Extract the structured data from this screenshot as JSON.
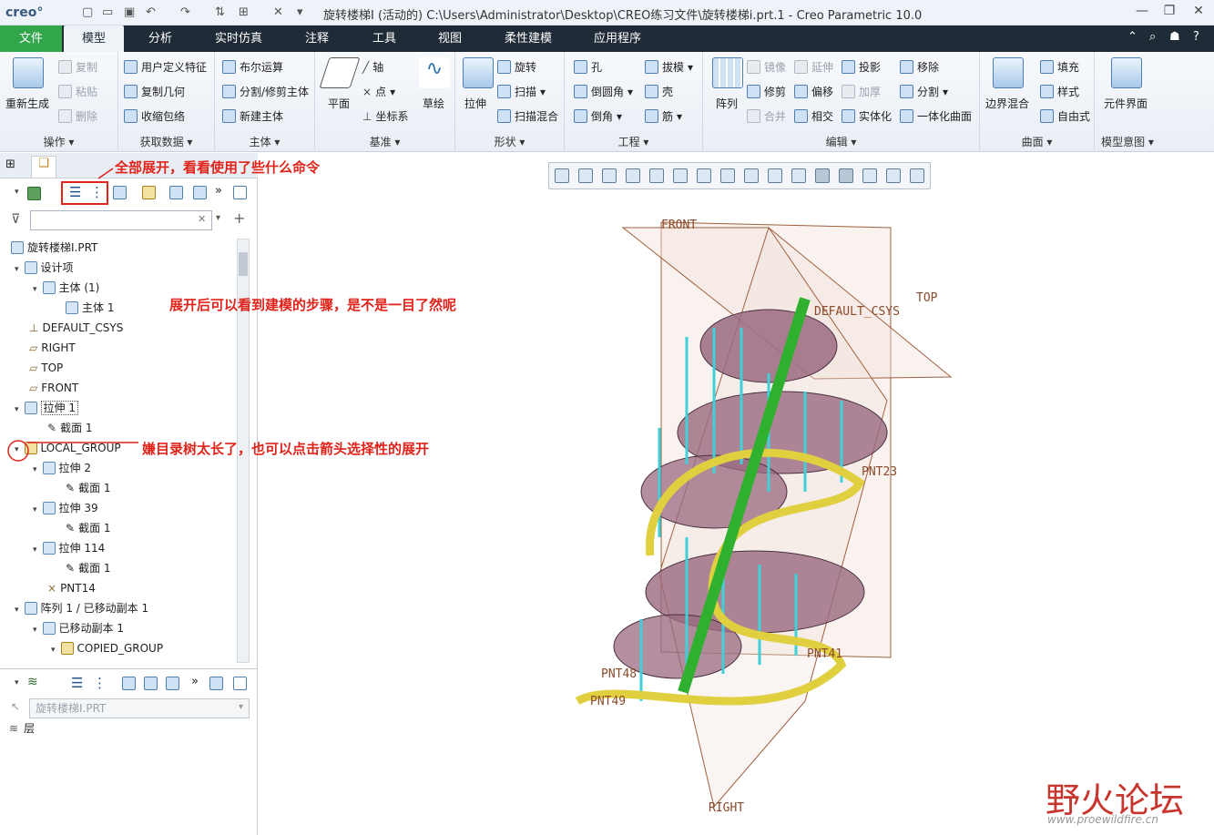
{
  "titlebar": {
    "logo": "creo°",
    "title": "旋转楼梯I (活动的) C:\\Users\\Administrator\\Desktop\\CREO练习文件\\旋转楼梯i.prt.1 - Creo Parametric 10.0"
  },
  "menu": {
    "tabs": [
      "文件",
      "模型",
      "分析",
      "实时仿真",
      "注释",
      "工具",
      "视图",
      "柔性建模",
      "应用程序"
    ],
    "active": "模型"
  },
  "ribbon": {
    "ops": {
      "label": "操作",
      "regen": "重新生成",
      "copy": "复制",
      "paste": "粘贴",
      "delete": "删除"
    },
    "getdata": {
      "label": "获取数据",
      "udf": "用户定义特征",
      "copygeom": "复制几何",
      "shrinkwrap": "收缩包络"
    },
    "body": {
      "label": "主体",
      "boolean": "布尔运算",
      "split": "分割/修剪主体",
      "newbody": "新建主体"
    },
    "datum": {
      "label": "基准",
      "plane": "平面",
      "axis": "轴",
      "point": "点",
      "csys": "坐标系",
      "sketch": "草绘"
    },
    "shapes": {
      "label": "形状",
      "extrude": "拉伸",
      "revolve": "旋转",
      "sweep": "扫描",
      "sweepblend": "扫描混合"
    },
    "eng": {
      "label": "工程",
      "hole": "孔",
      "round": "倒圆角",
      "chamfer": "倒角",
      "draft": "拔模",
      "shell": "壳",
      "rib": "筋"
    },
    "edit": {
      "label": "编辑",
      "pattern": "阵列",
      "mirror": "镜像",
      "extend": "延伸",
      "project": "投影",
      "trim": "修剪",
      "offset": "偏移",
      "thicken": "加厚",
      "merge": "合并",
      "intersect": "相交",
      "solidify": "实体化",
      "remove": "移除",
      "split": "分割",
      "unify": "一体化曲面"
    },
    "surf": {
      "label": "曲面",
      "boundary": "边界混合",
      "fill": "填充",
      "style": "样式",
      "freestyle": "自由式"
    },
    "intent": {
      "label": "模型意图",
      "component": "元件界面"
    }
  },
  "tree": {
    "search_placeholder": "",
    "rows": [
      "旋转楼梯I.PRT",
      "设计项",
      "主体 (1)",
      "主体 1",
      "DEFAULT_CSYS",
      "RIGHT",
      "TOP",
      "FRONT",
      "拉伸 1",
      "截面 1",
      "LOCAL_GROUP",
      "拉伸 2",
      "截面 1",
      "拉伸 39",
      "截面 1",
      "拉伸 114",
      "截面 1",
      "PNT14",
      "阵列 1 / 已移动副本 1",
      "已移动副本 1",
      "COPIED_GROUP"
    ]
  },
  "layer": {
    "model": "旋转楼梯I.PRT",
    "layers": "层"
  },
  "annotations": {
    "a1": "全部展开，看看使用了些什么命令",
    "a2": "展开后可以看到建模的步骤，是不是一目了然呢",
    "a3": "嫌目录树太长了，也可以点击箭头选择性的展开"
  },
  "graphics": {
    "front": "FRONT",
    "top": "TOP",
    "right": "RIGHT",
    "csys": "DEFAULT_CSYS",
    "pnt48": "PNT48",
    "pnt49": "PNT49",
    "pnt23": "PNT23",
    "pnt41": "PNT41"
  },
  "watermark": {
    "cn": "野火论坛",
    "url": "www.proewildfire.cn"
  }
}
